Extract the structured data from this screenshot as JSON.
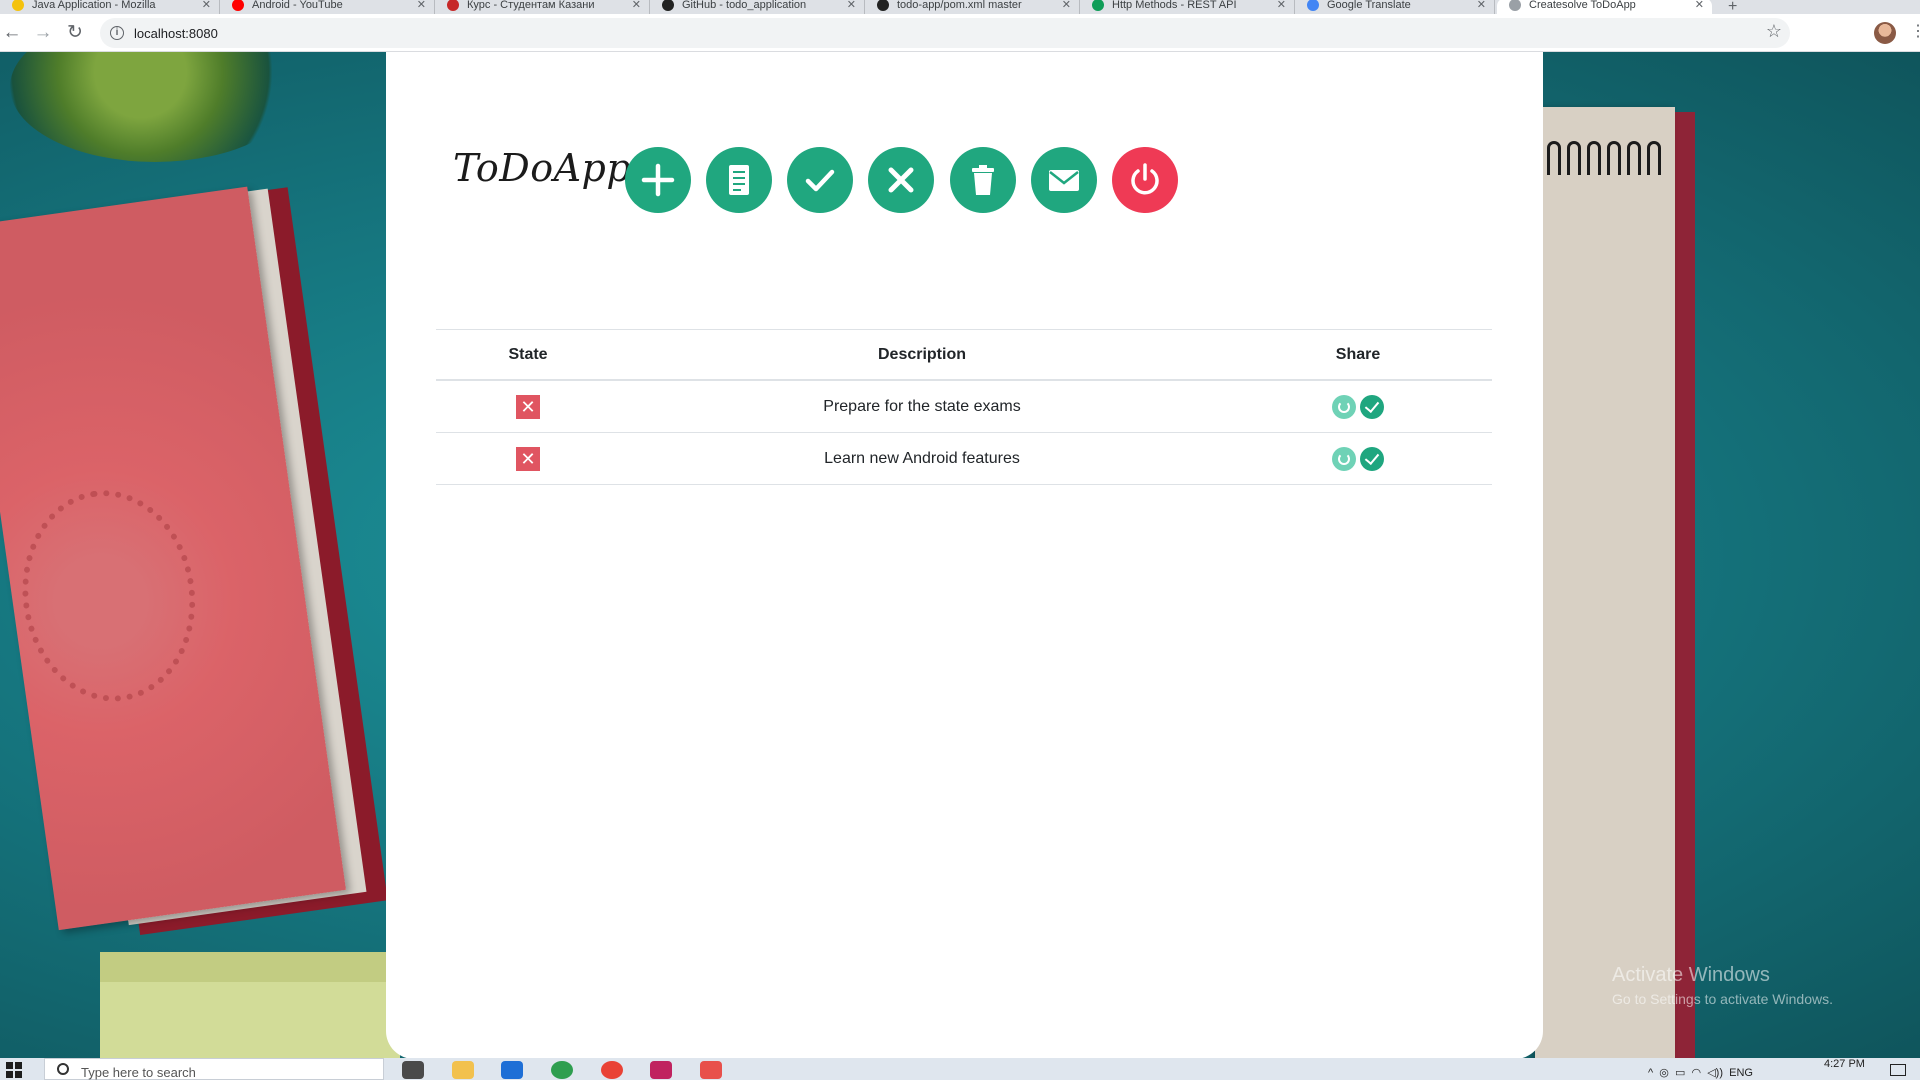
{
  "browser": {
    "tabs": [
      {
        "label": "Java Application - Mozilla",
        "favicon_color": "#f4c20d"
      },
      {
        "label": "Android - YouTube",
        "favicon_color": "#ff0000"
      },
      {
        "label": "Курс - Студентам Казани",
        "favicon_color": "#c62828"
      },
      {
        "label": "GitHub - todo_application",
        "favicon_color": "#222222"
      },
      {
        "label": "todo-app/pom.xml master",
        "favicon_color": "#222222"
      },
      {
        "label": "Http Methods - REST API",
        "favicon_color": "#0f9d58"
      },
      {
        "label": "Google Translate",
        "favicon_color": "#4285f4"
      },
      {
        "label": "Createsolve ToDoApp",
        "favicon_color": "#9aa0a6"
      }
    ],
    "active_tab_index": 7,
    "url": "localhost:8080"
  },
  "app": {
    "logo": "ToDoApp",
    "toolbar_buttons": [
      {
        "name": "add-task-button",
        "icon": "plus-icon",
        "color": "#20a77f"
      },
      {
        "name": "list-tasks-button",
        "icon": "document-list-icon",
        "color": "#20a77f"
      },
      {
        "name": "complete-task-button",
        "icon": "check-icon",
        "color": "#20a77f"
      },
      {
        "name": "cancel-task-button",
        "icon": "close-icon",
        "color": "#20a77f"
      },
      {
        "name": "delete-task-button",
        "icon": "trash-icon",
        "color": "#20a77f"
      },
      {
        "name": "email-button",
        "icon": "mail-icon",
        "color": "#20a77f"
      },
      {
        "name": "logout-button",
        "icon": "power-icon",
        "color": "#ef3a55"
      }
    ],
    "table": {
      "headers": [
        "State",
        "Description",
        "Share"
      ],
      "rows": [
        {
          "state_icon": "cross-icon",
          "description": "Prepare for the state exams",
          "share_icons": [
            "refresh-icon",
            "check-icon"
          ]
        },
        {
          "state_icon": "cross-icon",
          "description": "Learn new Android features",
          "share_icons": [
            "refresh-icon",
            "check-icon"
          ]
        }
      ]
    }
  },
  "watermark": {
    "title": "Activate Windows",
    "subtitle": "Go to Settings to activate Windows."
  },
  "taskbar": {
    "search_placeholder": "Type here to search",
    "tray_language": "ENG",
    "clock_time": "4:27 PM"
  }
}
